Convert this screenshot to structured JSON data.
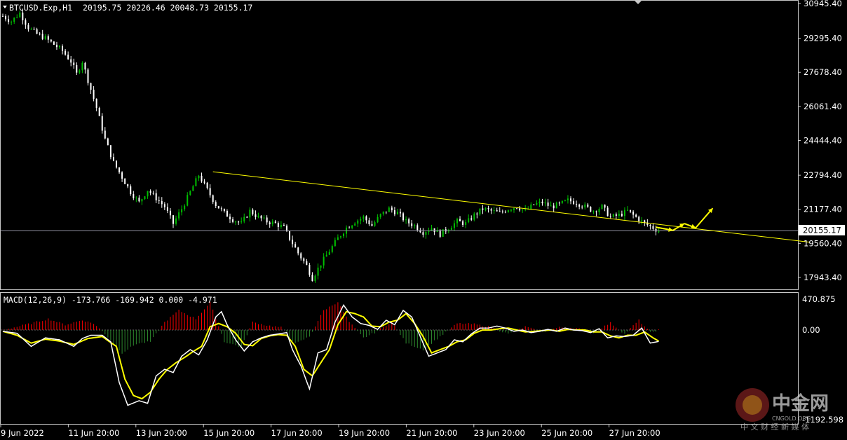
{
  "header": {
    "symbol": "BTCUSD.Exp,H1",
    "ohlc": "20195.75 20226.46 20048.73 20155.17",
    "current_price_label": "20155.17"
  },
  "macd": {
    "label": "MACD(12,26,9) -173.766 -169.942 0.000 -4.971",
    "top_label": "470.875",
    "zero_label": "0.00",
    "bottom_label": "-1192.598"
  },
  "watermark": {
    "brand": "中金网",
    "domain": "CNGOLD.ORG",
    "tagline": "中 文 财 经 新 媒 体"
  },
  "colors": {
    "bull": "#2e8b2e",
    "bear": "#ff0000",
    "candle_up": "#00c000",
    "candle_down": "#ffffff",
    "trend": "#ffff00",
    "macd_main": "#ffffff",
    "macd_signal": "#ffff00",
    "frame": "#c8c8c8",
    "price_line": "#9090a0"
  },
  "chart_data": {
    "type": "candlestick",
    "timeframe": "H1",
    "price_axis": {
      "ticks": [
        30945.4,
        29295.4,
        27678.4,
        26061.4,
        24444.4,
        22794.4,
        21177.4,
        19560.4,
        17943.4
      ],
      "current": 20155.17
    },
    "x_ticks": [
      "9 Jun 2022",
      "11 Jun 20:00",
      "13 Jun 20:00",
      "15 Jun 20:00",
      "17 Jun 20:00",
      "19 Jun 20:00",
      "21 Jun 20:00",
      "23 Jun 20:00",
      "25 Jun 20:00",
      "27 Jun 20:00"
    ],
    "close_path": [
      [
        0,
        30350
      ],
      [
        3,
        30100
      ],
      [
        6,
        30500
      ],
      [
        9,
        29800
      ],
      [
        12,
        29500
      ],
      [
        15,
        29300
      ],
      [
        18,
        29000
      ],
      [
        21,
        28700
      ],
      [
        24,
        28200
      ],
      [
        26,
        27600
      ],
      [
        28,
        28200
      ],
      [
        30,
        27300
      ],
      [
        33,
        26000
      ],
      [
        36,
        24500
      ],
      [
        39,
        23400
      ],
      [
        42,
        22700
      ],
      [
        45,
        22000
      ],
      [
        48,
        21500
      ],
      [
        51,
        22100
      ],
      [
        54,
        21700
      ],
      [
        57,
        21300
      ],
      [
        60,
        20500
      ],
      [
        63,
        21200
      ],
      [
        66,
        22000
      ],
      [
        69,
        22800
      ],
      [
        72,
        22100
      ],
      [
        75,
        21400
      ],
      [
        78,
        21000
      ],
      [
        81,
        20700
      ],
      [
        84,
        20500
      ],
      [
        87,
        21100
      ],
      [
        90,
        20800
      ],
      [
        93,
        20600
      ],
      [
        96,
        20500
      ],
      [
        99,
        20300
      ],
      [
        101,
        19800
      ],
      [
        104,
        19100
      ],
      [
        107,
        18500
      ],
      [
        109,
        17900
      ],
      [
        112,
        18600
      ],
      [
        115,
        19200
      ],
      [
        118,
        19800
      ],
      [
        121,
        20300
      ],
      [
        124,
        20600
      ],
      [
        127,
        20800
      ],
      [
        130,
        20400
      ],
      [
        133,
        20900
      ],
      [
        136,
        21200
      ],
      [
        139,
        21000
      ],
      [
        142,
        20600
      ],
      [
        145,
        20400
      ],
      [
        148,
        20100
      ],
      [
        151,
        20300
      ],
      [
        154,
        20000
      ],
      [
        157,
        20300
      ],
      [
        160,
        20600
      ],
      [
        163,
        20500
      ],
      [
        166,
        20900
      ],
      [
        169,
        21200
      ],
      [
        172,
        21100
      ],
      [
        175,
        21000
      ],
      [
        178,
        21200
      ],
      [
        181,
        21300
      ],
      [
        184,
        21100
      ],
      [
        187,
        21400
      ],
      [
        190,
        21500
      ],
      [
        193,
        21300
      ],
      [
        196,
        21400
      ],
      [
        199,
        21600
      ],
      [
        202,
        21500
      ],
      [
        205,
        21300
      ],
      [
        208,
        21100
      ],
      [
        211,
        21300
      ],
      [
        214,
        20800
      ],
      [
        217,
        20900
      ],
      [
        220,
        21100
      ],
      [
        223,
        20800
      ],
      [
        226,
        20500
      ],
      [
        229,
        20300
      ],
      [
        231,
        20155
      ]
    ],
    "trendline": {
      "from": [
        74,
        22960
      ],
      "to": [
        284,
        19620
      ]
    },
    "forecast_arrows": [
      {
        "from": [
          230,
          20330
        ],
        "to": [
          236,
          20180
        ]
      },
      {
        "from": [
          236,
          20180
        ],
        "to": [
          240,
          20500
        ]
      },
      {
        "from": [
          240,
          20500
        ],
        "to": [
          244,
          20300
        ]
      },
      {
        "from": [
          244,
          20300
        ],
        "to": [
          250,
          21230
        ]
      }
    ],
    "macd": {
      "params": [
        12,
        26,
        9
      ],
      "main": -173.766,
      "signal": -169.942,
      "hist": 0.0,
      "value4": -4.971,
      "range": [
        -1192.598,
        470.875
      ],
      "main_path": [
        [
          0,
          -20
        ],
        [
          5,
          -50
        ],
        [
          10,
          -250
        ],
        [
          15,
          -120
        ],
        [
          20,
          -150
        ],
        [
          25,
          -250
        ],
        [
          28,
          -130
        ],
        [
          31,
          -80
        ],
        [
          35,
          -80
        ],
        [
          38,
          -180
        ],
        [
          41,
          -800
        ],
        [
          44,
          -1150
        ],
        [
          48,
          -1080
        ],
        [
          51,
          -1120
        ],
        [
          54,
          -700
        ],
        [
          57,
          -600
        ],
        [
          60,
          -650
        ],
        [
          63,
          -400
        ],
        [
          66,
          -300
        ],
        [
          69,
          -380
        ],
        [
          72,
          -150
        ],
        [
          75,
          200
        ],
        [
          77,
          280
        ],
        [
          79,
          80
        ],
        [
          82,
          -150
        ],
        [
          85,
          -320
        ],
        [
          88,
          -180
        ],
        [
          91,
          -120
        ],
        [
          94,
          -80
        ],
        [
          97,
          -60
        ],
        [
          100,
          -40
        ],
        [
          102,
          -300
        ],
        [
          105,
          -550
        ],
        [
          108,
          -900
        ],
        [
          111,
          -350
        ],
        [
          114,
          -300
        ],
        [
          117,
          120
        ],
        [
          120,
          380
        ],
        [
          123,
          200
        ],
        [
          126,
          100
        ],
        [
          129,
          70
        ],
        [
          132,
          10
        ],
        [
          135,
          150
        ],
        [
          138,
          80
        ],
        [
          141,
          300
        ],
        [
          144,
          200
        ],
        [
          147,
          -100
        ],
        [
          150,
          -400
        ],
        [
          153,
          -350
        ],
        [
          156,
          -300
        ],
        [
          159,
          -150
        ],
        [
          162,
          -180
        ],
        [
          165,
          -60
        ],
        [
          168,
          30
        ],
        [
          171,
          30
        ],
        [
          174,
          60
        ],
        [
          177,
          30
        ],
        [
          180,
          -20
        ],
        [
          183,
          0
        ],
        [
          186,
          -40
        ],
        [
          189,
          -20
        ],
        [
          192,
          10
        ],
        [
          195,
          -20
        ],
        [
          198,
          30
        ],
        [
          201,
          0
        ],
        [
          204,
          -10
        ],
        [
          207,
          -40
        ],
        [
          210,
          20
        ],
        [
          213,
          -120
        ],
        [
          216,
          -90
        ],
        [
          219,
          -100
        ],
        [
          222,
          -80
        ],
        [
          225,
          30
        ],
        [
          228,
          -200
        ],
        [
          231,
          -174
        ]
      ],
      "signal_path": [
        [
          0,
          -20
        ],
        [
          5,
          -80
        ],
        [
          10,
          -200
        ],
        [
          15,
          -140
        ],
        [
          20,
          -170
        ],
        [
          25,
          -220
        ],
        [
          30,
          -130
        ],
        [
          35,
          -100
        ],
        [
          40,
          -250
        ],
        [
          43,
          -750
        ],
        [
          46,
          -1000
        ],
        [
          49,
          -1050
        ],
        [
          52,
          -950
        ],
        [
          55,
          -750
        ],
        [
          58,
          -600
        ],
        [
          61,
          -500
        ],
        [
          64,
          -420
        ],
        [
          67,
          -330
        ],
        [
          70,
          -250
        ],
        [
          73,
          50
        ],
        [
          76,
          100
        ],
        [
          79,
          50
        ],
        [
          82,
          -50
        ],
        [
          85,
          -220
        ],
        [
          88,
          -240
        ],
        [
          91,
          -130
        ],
        [
          94,
          -90
        ],
        [
          97,
          -70
        ],
        [
          100,
          -80
        ],
        [
          103,
          -250
        ],
        [
          106,
          -600
        ],
        [
          109,
          -700
        ],
        [
          112,
          -500
        ],
        [
          115,
          -300
        ],
        [
          118,
          80
        ],
        [
          121,
          280
        ],
        [
          124,
          250
        ],
        [
          127,
          200
        ],
        [
          130,
          60
        ],
        [
          133,
          50
        ],
        [
          136,
          120
        ],
        [
          139,
          150
        ],
        [
          142,
          250
        ],
        [
          145,
          100
        ],
        [
          148,
          -100
        ],
        [
          151,
          -350
        ],
        [
          154,
          -300
        ],
        [
          157,
          -250
        ],
        [
          160,
          -180
        ],
        [
          163,
          -150
        ],
        [
          166,
          -50
        ],
        [
          169,
          0
        ],
        [
          172,
          0
        ],
        [
          175,
          20
        ],
        [
          178,
          30
        ],
        [
          181,
          0
        ],
        [
          184,
          -30
        ],
        [
          187,
          -20
        ],
        [
          190,
          -10
        ],
        [
          193,
          0
        ],
        [
          196,
          -20
        ],
        [
          199,
          10
        ],
        [
          202,
          0
        ],
        [
          205,
          0
        ],
        [
          208,
          -30
        ],
        [
          211,
          -30
        ],
        [
          214,
          -90
        ],
        [
          217,
          -120
        ],
        [
          220,
          -80
        ],
        [
          223,
          -80
        ],
        [
          226,
          -30
        ],
        [
          229,
          -120
        ],
        [
          231,
          -170
        ]
      ],
      "hist_path": [
        [
          0,
          0
        ],
        [
          10,
          100
        ],
        [
          16,
          170
        ],
        [
          22,
          80
        ],
        [
          28,
          150
        ],
        [
          32,
          100
        ],
        [
          36,
          -60
        ],
        [
          42,
          -350
        ],
        [
          47,
          -210
        ],
        [
          52,
          -180
        ],
        [
          57,
          120
        ],
        [
          62,
          300
        ],
        [
          68,
          170
        ],
        [
          73,
          420
        ],
        [
          78,
          -180
        ],
        [
          84,
          -260
        ],
        [
          88,
          120
        ],
        [
          93,
          70
        ],
        [
          98,
          40
        ],
        [
          103,
          -210
        ],
        [
          108,
          -100
        ],
        [
          113,
          300
        ],
        [
          118,
          430
        ],
        [
          122,
          120
        ],
        [
          127,
          -120
        ],
        [
          131,
          -40
        ],
        [
          137,
          130
        ],
        [
          142,
          -200
        ],
        [
          148,
          -300
        ],
        [
          154,
          -100
        ],
        [
          160,
          100
        ],
        [
          166,
          90
        ],
        [
          172,
          40
        ],
        [
          178,
          -60
        ],
        [
          184,
          50
        ],
        [
          190,
          -30
        ],
        [
          196,
          40
        ],
        [
          202,
          30
        ],
        [
          208,
          -40
        ],
        [
          214,
          110
        ],
        [
          219,
          -60
        ],
        [
          224,
          150
        ],
        [
          228,
          -40
        ],
        [
          231,
          0
        ]
      ]
    }
  }
}
